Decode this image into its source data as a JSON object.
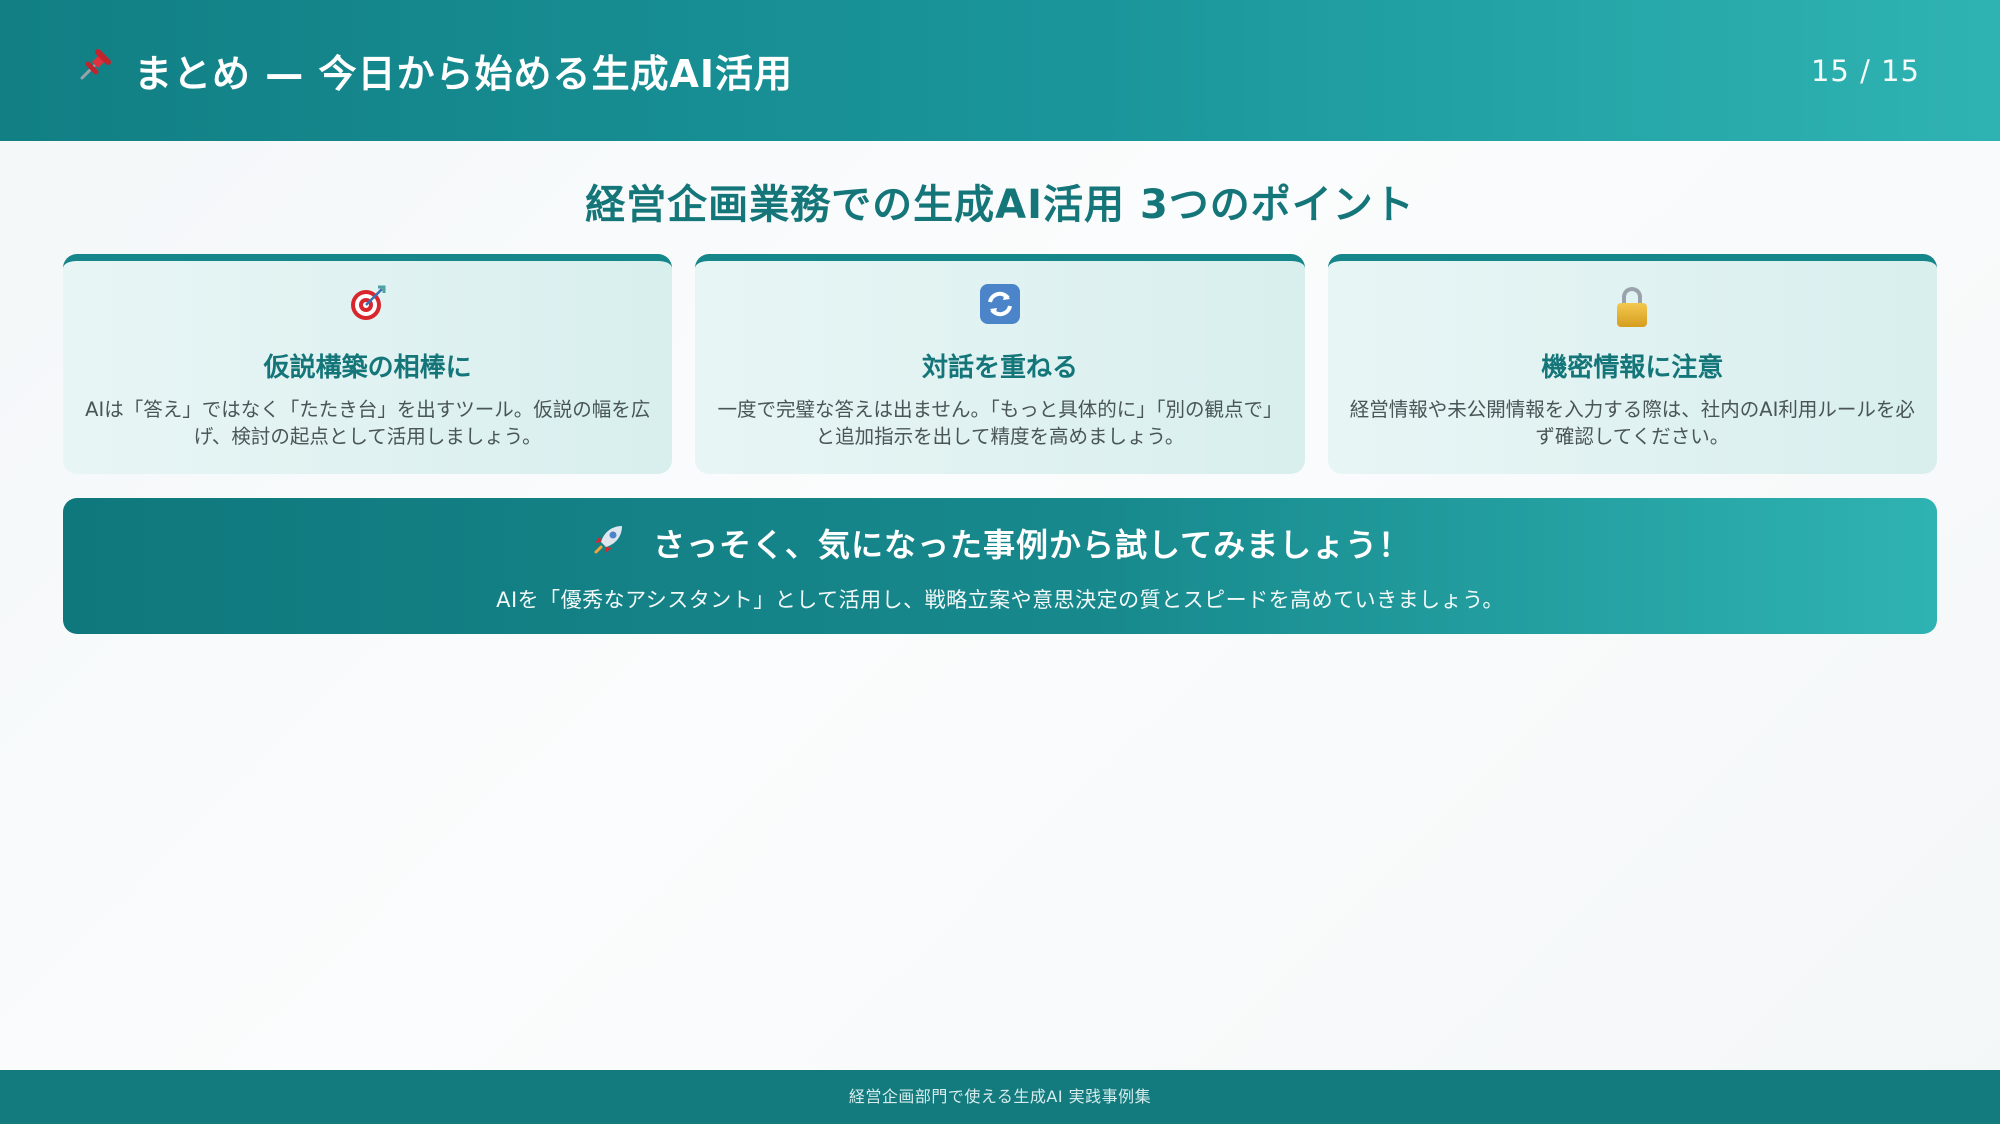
{
  "header": {
    "icon": "pushpin-icon",
    "title": "まとめ — 今日から始める生成AI活用",
    "page_indicator": "15 / 15"
  },
  "main": {
    "heading": "経営企画業務での生成AI活用 3つのポイント",
    "cards": [
      {
        "icon": "target-icon",
        "title": "仮説構築の相棒に",
        "text": "AIは「答え」ではなく「たたき台」を出すツール。仮説の幅を広げ、検討の起点として活用しましょう。"
      },
      {
        "icon": "refresh-icon",
        "title": "対話を重ねる",
        "text": "一度で完璧な答えは出ません。「もっと具体的に」「別の観点で」と追加指示を出して精度を高めましょう。"
      },
      {
        "icon": "lock-icon",
        "title": "機密情報に注意",
        "text": "経営情報や未公開情報を入力する際は、社内のAI利用ルールを必ず確認してください。"
      }
    ],
    "cta": {
      "icon": "rocket-icon",
      "title": "さっそく、気になった事例から試してみましょう！",
      "text": "AIを「優秀なアシスタント」として活用し、戦略立案や意思決定の質とスピードを高めていきましょう。"
    }
  },
  "footer": {
    "text": "経営企画部門で使える生成AI 実践事例集"
  },
  "colors": {
    "accent": "#15767a",
    "header_start": "#117f84",
    "header_end": "#2fb3b2",
    "card_bg": "#e3f3f3",
    "footer_bg": "#137a7e"
  }
}
